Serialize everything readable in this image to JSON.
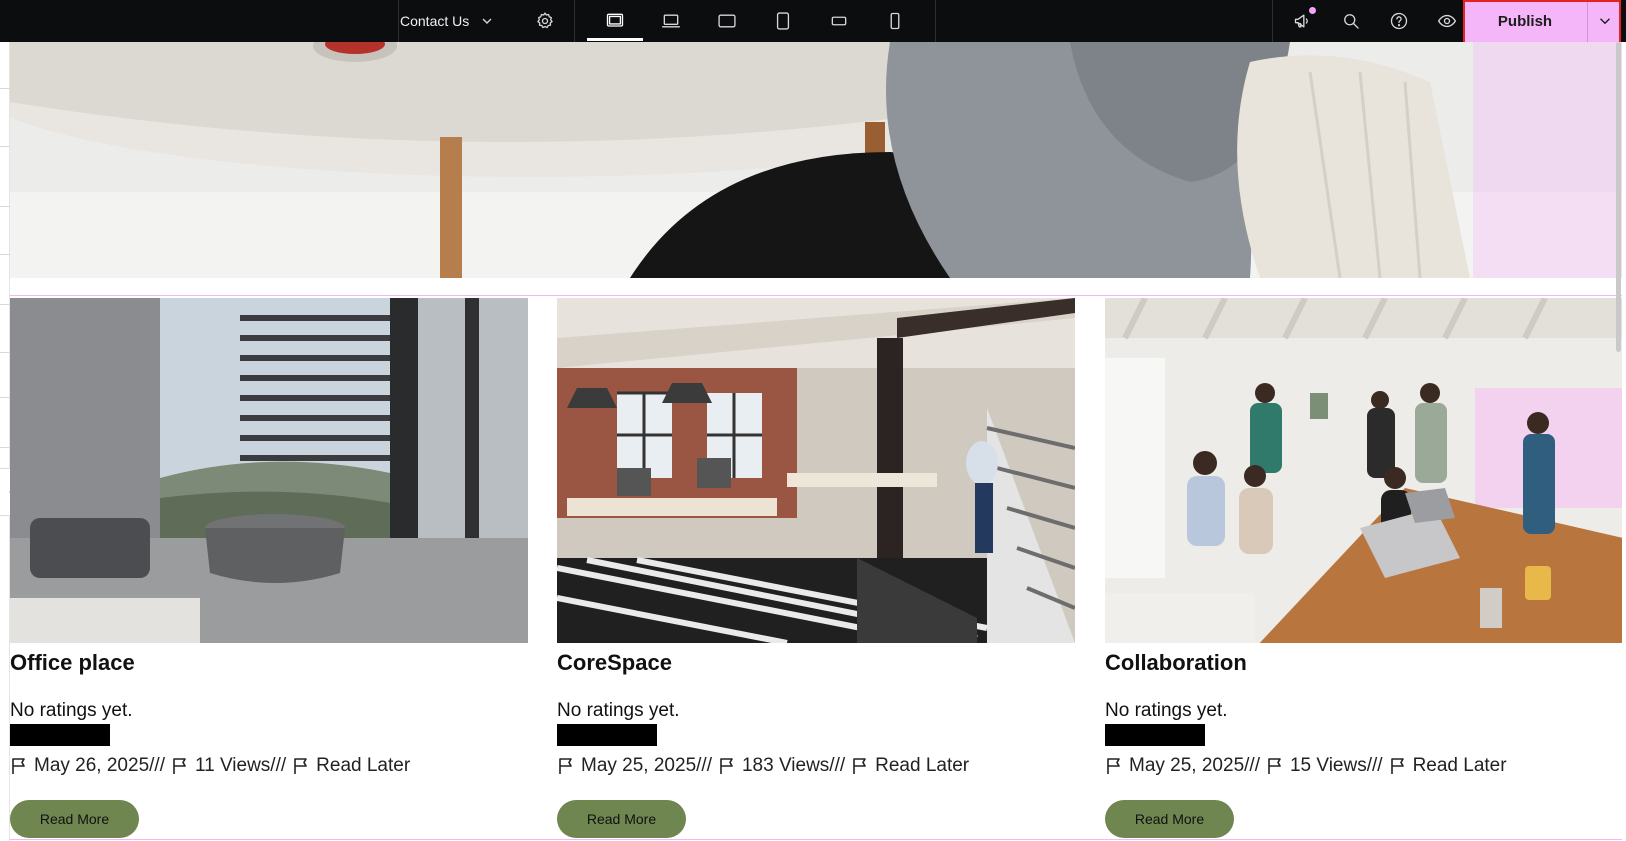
{
  "topbar": {
    "page_name": "Contact Us",
    "icons": {
      "chevron": "chevron-down-icon",
      "settings": "gear-icon",
      "devices": [
        "desktop-icon",
        "laptop-icon",
        "tablet-landscape-icon",
        "tablet-portrait-icon",
        "mobile-landscape-icon",
        "mobile-portrait-icon"
      ],
      "notifications": "megaphone-icon",
      "search": "search-icon",
      "help": "help-icon",
      "preview": "eye-icon"
    },
    "active_device": "desktop",
    "publish_label": "Publish",
    "colors": {
      "bar": "#0c0d0e",
      "publish": "#f4b6f8",
      "highlight": "#e32222"
    }
  },
  "cards": [
    {
      "title": "Office place",
      "rating": "No ratings yet.",
      "date": "May 26, 2025///",
      "views": "11 Views///",
      "read_later": "Read Later",
      "button": "Read More"
    },
    {
      "title": "CoreSpace",
      "rating": "No ratings yet.",
      "date": "May 25, 2025///",
      "views": "183 Views///",
      "read_later": "Read Later",
      "button": "Read More"
    },
    {
      "title": "Collaboration",
      "rating": "No ratings yet.",
      "date": "May 25, 2025///",
      "views": "15 Views///",
      "read_later": "Read Later",
      "button": "Read More"
    }
  ],
  "colors": {
    "read_more_button": "#6f8650",
    "section_guide": "#f1b8f4"
  }
}
